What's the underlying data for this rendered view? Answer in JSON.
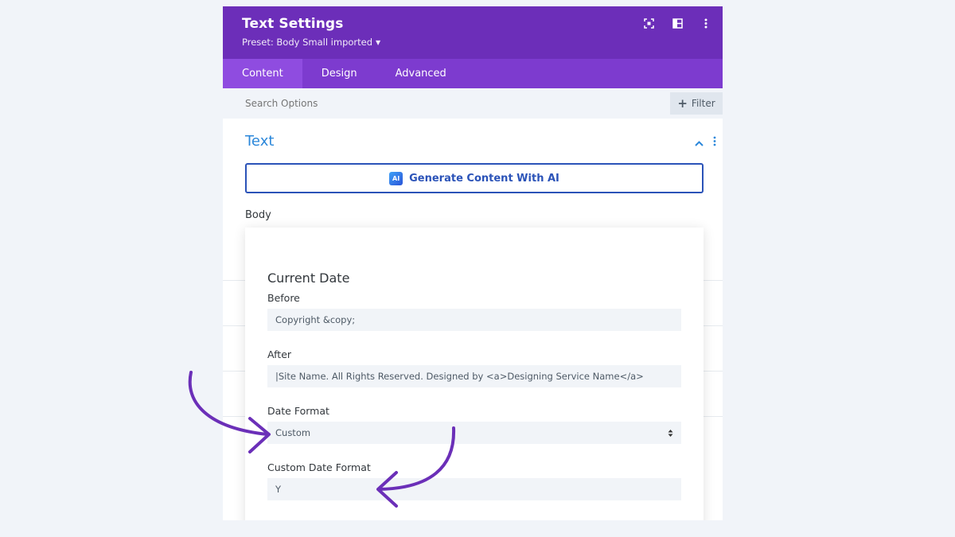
{
  "header": {
    "title": "Text Settings",
    "preset": "Preset: Body Small imported",
    "icons": [
      "focus-icon",
      "split-view-icon",
      "more-options-icon"
    ]
  },
  "tabs": [
    {
      "label": "Content",
      "active": true
    },
    {
      "label": "Design",
      "active": false
    },
    {
      "label": "Advanced",
      "active": false
    }
  ],
  "search": {
    "placeholder": "Search Options",
    "filter_label": "Filter"
  },
  "section": {
    "title": "Text",
    "ai_button": "Generate Content With AI",
    "ai_badge": "AI",
    "body_label": "Body"
  },
  "popup": {
    "title": "Current Date",
    "before_label": "Before",
    "before_value": "Copyright &copy;",
    "after_label": "After",
    "after_value": "|Site Name. All Rights Reserved. Designed by <a>Designing Service Name</a>",
    "date_format_label": "Date Format",
    "date_format_value": "Custom",
    "custom_format_label": "Custom Date Format",
    "custom_format_value": "Y"
  },
  "colors": {
    "header_bg": "#6c2eb9",
    "tabs_bg": "#7d3bcf",
    "active_tab": "#8f4ce0",
    "section_title": "#2b87da",
    "ai_button": "#2b53b8",
    "arrow": "#6b2fb8"
  }
}
